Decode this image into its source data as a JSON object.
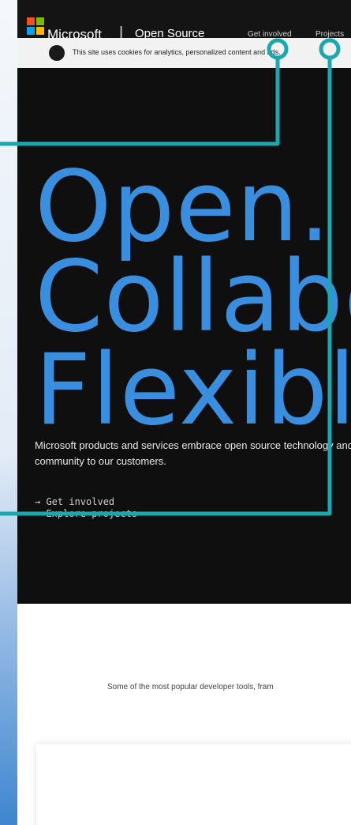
{
  "nav": {
    "brand": "Microsoft",
    "separator": "|",
    "site_name": "Open Source",
    "links": [
      "Get involved",
      "Projects"
    ]
  },
  "cookie_banner": {
    "text": "This site uses cookies for analytics, personalized content and ads."
  },
  "hero": {
    "lines": [
      "Open.",
      "Collabor",
      "Flexible."
    ],
    "description": "Microsoft products and services embrace open source technology and community to our customers.",
    "links": [
      "→ Get involved",
      "→ Explore projects"
    ]
  },
  "popular": {
    "text": "Some of the most popular developer tools, fram"
  },
  "colors": {
    "hero_blue": "#3a8ee0",
    "annotation_teal": "#1aa8b0",
    "nav_bg": "#141414",
    "hero_bg": "#0f0f0f"
  },
  "icons": [
    "microsoft-logo-icon",
    "cookie-info-icon",
    "arrow-right-icon",
    "project-logo-icon"
  ]
}
